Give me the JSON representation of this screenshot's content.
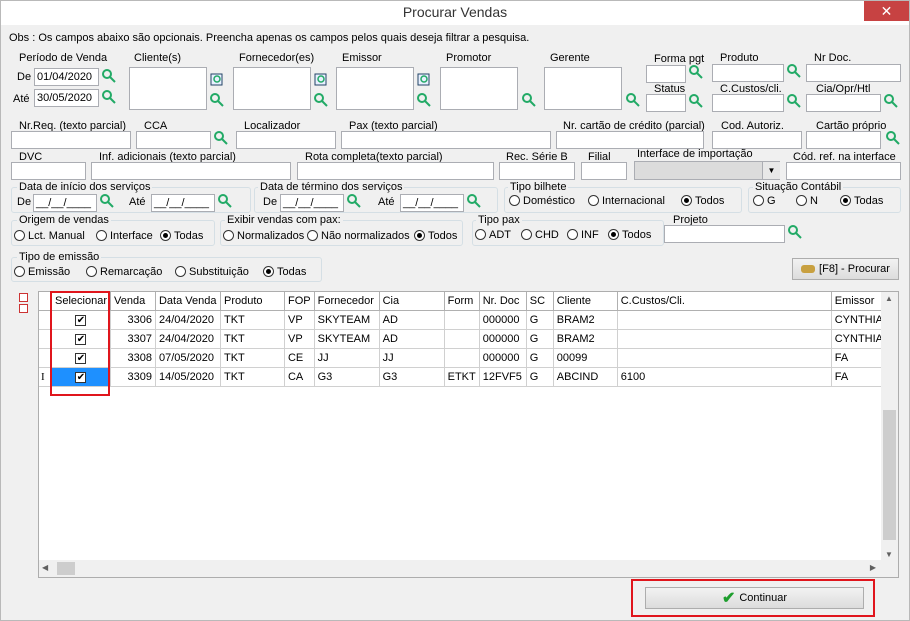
{
  "window": {
    "title": "Procurar Vendas",
    "close": "✕"
  },
  "obs": "Obs : Os campos abaixo são opcionais. Preencha apenas os campos pelos quais deseja filtrar a pesquisa.",
  "filters": {
    "periodo": {
      "label": "Período de Venda",
      "de_label": "De",
      "de_value": "01/04/2020",
      "ate_label": "Até",
      "ate_value": "30/05/2020"
    },
    "clientes": "Cliente(s)",
    "fornecedores": "Fornecedor(es)",
    "emissor": "Emissor",
    "promotor": "Promotor",
    "gerente": "Gerente",
    "forma_pgt": "Forma pgt",
    "produto": "Produto",
    "nr_doc": "Nr Doc.",
    "status": "Status",
    "ccustos": "C.Custos/cli.",
    "cia": "Cia/Opr/Htl",
    "nr_req": "Nr.Req. (texto parcial)",
    "cca": "CCA",
    "localizador": "Localizador",
    "pax": "Pax (texto parcial)",
    "cartao": "Nr. cartão de crédito (parcial)",
    "cod_autoriz": "Cod. Autoriz.",
    "cartao_proprio": "Cartão próprio",
    "dvc": "DVC",
    "inf_adicionais": "Inf. adicionais (texto parcial)",
    "rota": "Rota completa(texto parcial)",
    "rec_serie": "Rec. Série B",
    "filial": "Filial",
    "interface_import": "Interface de importação",
    "cod_ref": "Cód. ref. na interface",
    "data_inicio": {
      "label": "Data de início dos serviços",
      "de_label": "De",
      "de_value": "__/__/____",
      "ate_label": "Até",
      "ate_value": "__/__/____"
    },
    "data_termino": {
      "label": "Data de término dos serviços",
      "de_label": "De",
      "de_value": "__/__/____",
      "ate_label": "Até",
      "ate_value": "__/__/____"
    },
    "tipo_bilhete": {
      "label": "Tipo bilhete",
      "options": [
        "Doméstico",
        "Internacional",
        "Todos"
      ],
      "selected": 2
    },
    "situacao_contabil": {
      "label": "Situação Contábil",
      "options": [
        "G",
        "N",
        "Todas"
      ],
      "selected": 2
    },
    "origem_vendas": {
      "label": "Origem de vendas",
      "options": [
        "Lct. Manual",
        "Interface",
        "Todas"
      ],
      "selected": 2
    },
    "exibir_pax": {
      "label": "Exibir vendas com pax:",
      "options": [
        "Normalizados",
        "Não normalizados",
        "Todos"
      ],
      "selected": 2
    },
    "tipo_pax": {
      "label": "Tipo pax",
      "options": [
        "ADT",
        "CHD",
        "INF",
        "Todos"
      ],
      "selected": 3
    },
    "projeto": "Projeto",
    "tipo_emissao": {
      "label": "Tipo de emissão",
      "options": [
        "Emissão",
        "Remarcação",
        "Substituição",
        "Todas"
      ],
      "selected": 3
    }
  },
  "procurar_button": "[F8] - Procurar",
  "grid": {
    "columns": [
      "Selecionar",
      "Venda",
      "Data Venda",
      "Produto",
      "FOP",
      "Fornecedor",
      "Cia",
      "Form",
      "Nr. Doc",
      "SC",
      "Cliente",
      "C.Custos/Cli.",
      "Emissor"
    ],
    "rows": [
      {
        "sel": "✔",
        "venda": "3306",
        "data": "24/04/2020",
        "produto": "TKT",
        "fop": "VP",
        "fornecedor": "SKYTEAM",
        "cia": "AD",
        "form": "",
        "nrdoc": "000000",
        "sc": "G",
        "cliente": "BRAM2",
        "ccustos": "",
        "emissor": "CYNTHIA"
      },
      {
        "sel": "✔",
        "venda": "3307",
        "data": "24/04/2020",
        "produto": "TKT",
        "fop": "VP",
        "fornecedor": "SKYTEAM",
        "cia": "AD",
        "form": "",
        "nrdoc": "000000",
        "sc": "G",
        "cliente": "BRAM2",
        "ccustos": "",
        "emissor": "CYNTHIA"
      },
      {
        "sel": "✔",
        "venda": "3308",
        "data": "07/05/2020",
        "produto": "TKT",
        "fop": "CE",
        "fornecedor": "JJ",
        "cia": "JJ",
        "form": "",
        "nrdoc": "000000",
        "sc": "G",
        "cliente": "00099",
        "ccustos": "",
        "emissor": "FA"
      },
      {
        "sel": "✔",
        "venda": "3309",
        "data": "14/05/2020",
        "produto": "TKT",
        "fop": "CA",
        "fornecedor": "G3",
        "cia": "G3",
        "form": "ETKT",
        "nrdoc": "12FVF5",
        "sc": "G",
        "cliente": "ABCIND",
        "ccustos": "6100",
        "emissor": "FA"
      }
    ],
    "row_marker": "I"
  },
  "continuar_button": "Continuar"
}
